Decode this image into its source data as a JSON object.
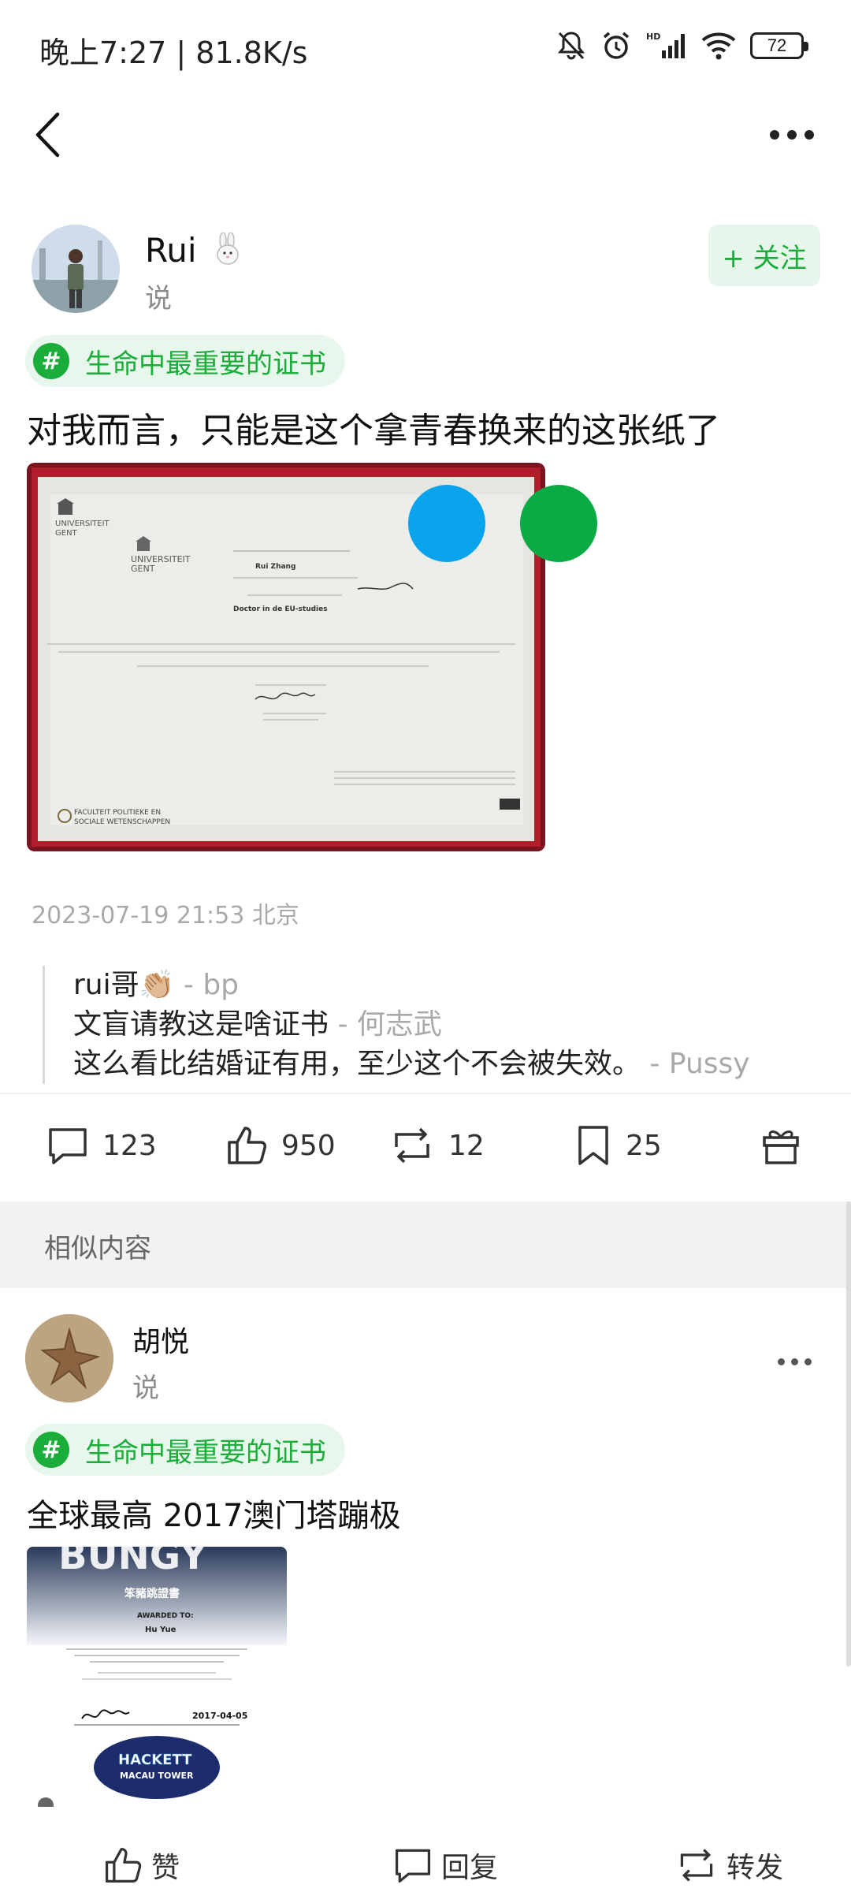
{
  "status_bar": {
    "time": "晚上7:27 | 81.8K/s",
    "battery": "72"
  },
  "post": {
    "author": {
      "name": "Rui",
      "badge_icon": "rabbit-icon",
      "action": "说"
    },
    "follow_label": "+ 关注",
    "topic": {
      "icon": "#",
      "label": "生命中最重要的证书"
    },
    "text": "对我而言，只能是这个拿青春换来的这张纸了",
    "image": {
      "university": "UNIVERSITEIT GENT",
      "holder": "Rui Zhang",
      "degree": "Doctor in de EU-studies",
      "faculty": "FACULTEIT POLITIEKE EN SOCIALE WETENSCHAPPEN"
    },
    "meta": "2023-07-19 21:53 北京",
    "comments": [
      {
        "text": "rui哥👏🏼",
        "author": " - bp"
      },
      {
        "text": "文盲请教这是啥证书",
        "author": " - 何志武"
      },
      {
        "text": "这么看比结婚证有用，至少这个不会被失效。",
        "author": " - Pussy"
      }
    ],
    "actions": {
      "comments": "123",
      "likes": "950",
      "reposts": "12",
      "bookmarks": "25"
    }
  },
  "section": {
    "title": "相似内容"
  },
  "post2": {
    "author": {
      "name": "胡悦",
      "action": "说"
    },
    "topic": {
      "icon": "#",
      "label": "生命中最重要的证书"
    },
    "text": "全球最高 2017澳门塔蹦极",
    "image": {
      "banner": "BUNGY",
      "title_cn": "笨豬跳證書",
      "awarded_to": "AWARDED TO:",
      "name": "Hu Yue",
      "date": "2017-04-05",
      "brand": "HACKETT",
      "brand_sub": "MACAU TOWER"
    }
  },
  "bottom_bar": {
    "like": "赞",
    "reply": "回复",
    "repost": "转发"
  },
  "colors": {
    "accent_green": "#1aad3a",
    "topic_bg": "#e8f7ec",
    "blue_dot": "#0aa4ec",
    "green_dot": "#0aab44"
  }
}
